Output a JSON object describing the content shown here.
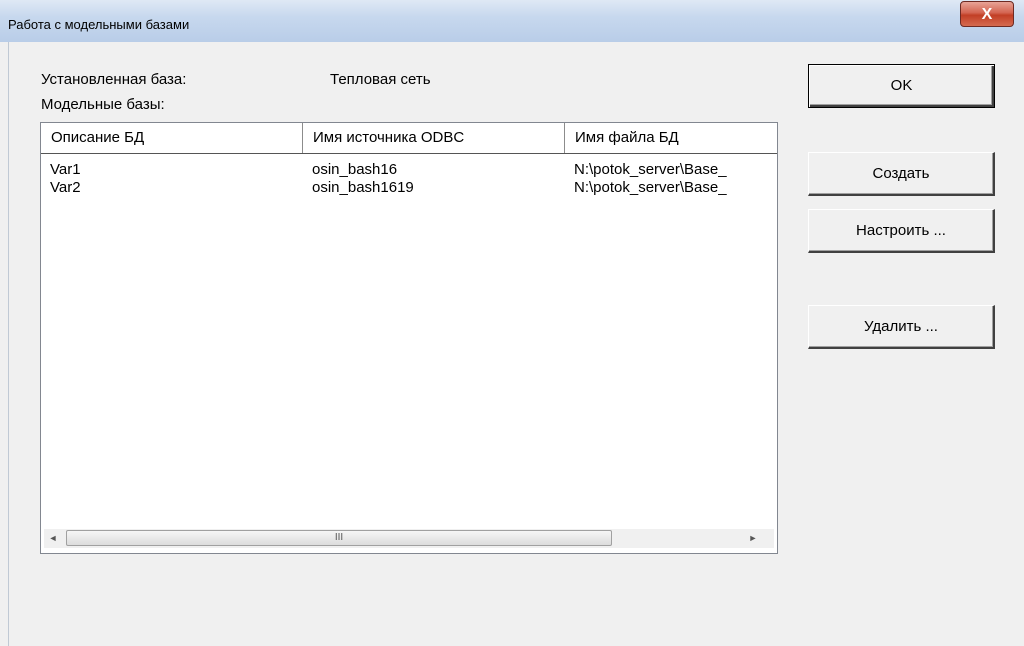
{
  "window": {
    "title": "Работа с модельными базами",
    "close_glyph": "X"
  },
  "info": {
    "installed_label": "Установленная база:",
    "installed_value": "Тепловая сеть",
    "models_label": "Модельные базы:"
  },
  "table": {
    "columns": [
      "Описание БД",
      "Имя источника ODBC",
      "Имя файла БД"
    ],
    "rows": [
      [
        "Var1",
        "osin_bash16",
        "N:\\potok_server\\Base_"
      ],
      [
        "Var2",
        "osin_bash1619",
        "N:\\potok_server\\Base_"
      ]
    ]
  },
  "scrollbar": {
    "left_arrow": "◄",
    "right_arrow": "►",
    "thumb_grip": "III"
  },
  "buttons": {
    "ok": "OK",
    "create": "Создать",
    "configure": "Настроить ...",
    "delete": "Удалить ..."
  }
}
